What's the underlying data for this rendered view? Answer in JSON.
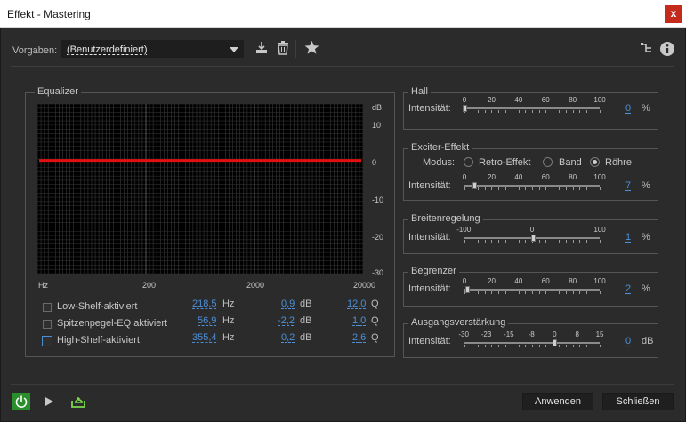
{
  "window": {
    "title": "Effekt - Mastering",
    "close_glyph": "x"
  },
  "toolbar": {
    "preset_label": "Vorgaben:",
    "preset_value": "(Benutzerdefiniert)",
    "icons": [
      "save-preset-icon",
      "delete-preset-icon",
      "favorite-star-icon",
      "routing-icon",
      "info-icon"
    ]
  },
  "equalizer": {
    "title": "Equalizer",
    "db_label": "dB",
    "y_ticks": [
      "10",
      "0",
      "-10",
      "-20",
      "-30"
    ],
    "x_unit": "Hz",
    "x_ticks": [
      "200",
      "2000",
      "20000"
    ],
    "curve_color": "#e01010",
    "curve_db": 0,
    "rows": [
      {
        "label": "Low-Shelf-aktiviert",
        "freq": "218,5",
        "freq_unit": "Hz",
        "gain": "0,9",
        "gain_unit": "dB",
        "q": "12,0",
        "q_unit": "Q",
        "checked": false
      },
      {
        "label": "Spitzenpegel-EQ aktiviert",
        "freq": "56,9",
        "freq_unit": "Hz",
        "gain": "-2,2",
        "gain_unit": "dB",
        "q": "1,0",
        "q_unit": "Q",
        "checked": false
      },
      {
        "label": "High-Shelf-aktiviert",
        "freq": "355,4",
        "freq_unit": "Hz",
        "gain": "0,2",
        "gain_unit": "dB",
        "q": "2,6",
        "q_unit": "Q",
        "checked": false
      }
    ]
  },
  "hall": {
    "title": "Hall",
    "label": "Intensität:",
    "ticks": [
      "0",
      "20",
      "40",
      "60",
      "80",
      "100"
    ],
    "value": "0",
    "unit": "%",
    "level": 0
  },
  "exciter": {
    "title": "Exciter-Effekt",
    "mode_label": "Modus:",
    "modes": [
      "Retro-Effekt",
      "Band",
      "Röhre"
    ],
    "selected_mode": "Röhre",
    "label": "Intensität:",
    "ticks": [
      "0",
      "20",
      "40",
      "60",
      "80",
      "100"
    ],
    "value": "7",
    "unit": "%",
    "level": 0.07
  },
  "width": {
    "title": "Breitenregelung",
    "label": "Intensität:",
    "ticks": [
      "-100",
      "0",
      "100"
    ],
    "value": "1",
    "unit": "%",
    "level": 0.505
  },
  "limiter": {
    "title": "Begrenzer",
    "label": "Intensität:",
    "ticks": [
      "0",
      "20",
      "40",
      "60",
      "80",
      "100"
    ],
    "value": "2",
    "unit": "%",
    "level": 0.02
  },
  "gain": {
    "title": "Ausgangsverstärkung",
    "label": "Intensität:",
    "ticks": [
      "-30",
      "-23",
      "-15",
      "-8",
      "0",
      "8",
      "15"
    ],
    "value": "0",
    "unit": "dB",
    "level": 0.667
  },
  "footer": {
    "apply": "Anwenden",
    "close": "Schließen",
    "power_color": "#2a8f2a",
    "accent": "#7ad94a"
  }
}
